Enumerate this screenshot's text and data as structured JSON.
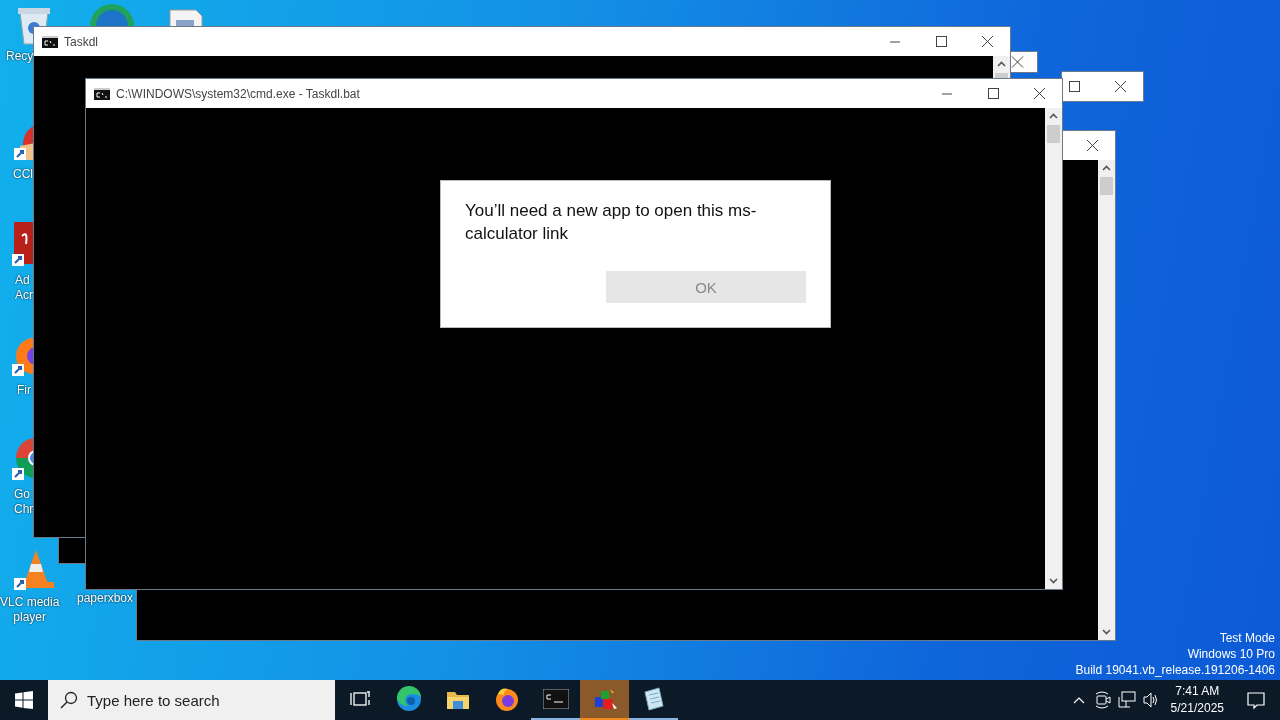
{
  "desktop_icons": [
    {
      "kind": "recycle-bin",
      "lines": [
        "Recy"
      ]
    },
    {
      "kind": "edge"
    },
    {
      "kind": "document"
    },
    {
      "kind": "ccleaner",
      "lines": [
        "CCl"
      ]
    },
    {
      "kind": "acrobat",
      "lines": [
        "Ad",
        "Acr"
      ]
    },
    {
      "kind": "firefox",
      "lines": [
        "Fir"
      ]
    },
    {
      "kind": "chrome",
      "lines": [
        "Go",
        "Chr"
      ]
    },
    {
      "kind": "vlc",
      "lines": [
        "VLC media",
        "player"
      ]
    },
    {
      "kind": "paper",
      "lines": [
        "paperxbox"
      ]
    }
  ],
  "windows": [
    {
      "kind": "console"
    },
    {
      "kind": "console"
    },
    {
      "kind": "console"
    },
    {
      "kind": "console"
    },
    {
      "kind": "console",
      "title": "Taskdl"
    },
    {
      "kind": "console",
      "title": "C:\\WINDOWS\\system32\\cmd.exe - Taskdl.bat"
    }
  ],
  "dialog": {
    "message": "You’ll need a new app to open this ms-calculator link",
    "button": {
      "label": "OK",
      "disabled": true
    }
  },
  "watermark": [
    "Test Mode",
    "Windows 10 Pro",
    "Build 19041.vb_release.191206-1406"
  ],
  "taskbar": {
    "search": {
      "placeholder": "Type here to search"
    },
    "apps": [
      {
        "kind": "task-view",
        "running": false,
        "selected": false
      },
      {
        "kind": "edge",
        "running": false,
        "selected": false
      },
      {
        "kind": "folder",
        "running": false,
        "selected": false
      },
      {
        "kind": "firefox",
        "running": false,
        "selected": false
      },
      {
        "kind": "console",
        "running": true,
        "selected": false
      },
      {
        "kind": "cubes",
        "running": true,
        "selected": true
      },
      {
        "kind": "notepad",
        "running": true,
        "selected": false
      }
    ],
    "clock": {
      "time": "7:41 AM",
      "date": "5/21/2025"
    }
  }
}
